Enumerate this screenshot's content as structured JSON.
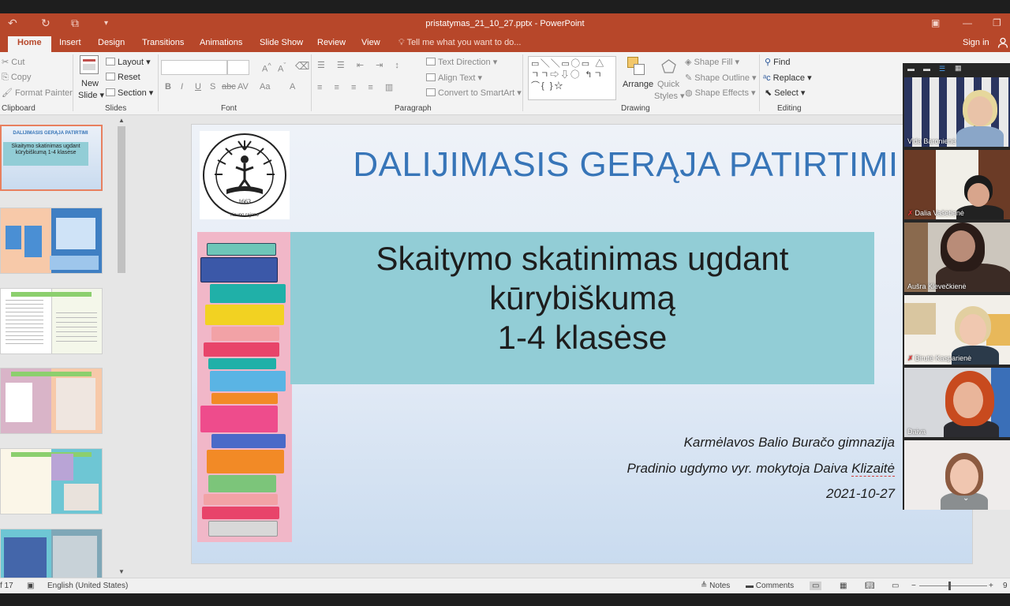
{
  "window": {
    "title": "pristatymas_21_10_27.pptx - PowerPoint",
    "sign_in": "Sign in"
  },
  "tabs": [
    "Home",
    "Insert",
    "Design",
    "Transitions",
    "Animations",
    "Slide Show",
    "Review",
    "View"
  ],
  "tell_me": "Tell me what you want to do...",
  "ribbon": {
    "clipboard": {
      "cut": "Cut",
      "copy": "Copy",
      "format_painter": "Format Painter",
      "group": "Clipboard"
    },
    "slides": {
      "new_slide": "New",
      "new_slide_2": "Slide",
      "layout": "Layout",
      "reset": "Reset",
      "section": "Section",
      "group": "Slides"
    },
    "font": {
      "group": "Font",
      "bold": "B",
      "italic": "I",
      "underline": "U",
      "strike": "S",
      "abc": "abc",
      "spacing": "AV",
      "case": "Aa",
      "color": "A"
    },
    "paragraph": {
      "text_direction": "Text Direction",
      "align_text": "Align Text",
      "convert_smartart": "Convert to SmartArt",
      "group": "Paragraph"
    },
    "drawing": {
      "arrange": "Arrange",
      "quick": "Quick",
      "styles": "Styles",
      "shape_fill": "Shape Fill",
      "shape_outline": "Shape Outline",
      "shape_effects": "Shape Effects",
      "group": "Drawing",
      "shapes": "▭╲╲▭◯▭ △ㄱㄱ⇨⇩◯ ↰ㄱ⌒{ }☆"
    },
    "editing": {
      "find": "Find",
      "replace": "Replace",
      "select": "Select",
      "group": "Editing"
    }
  },
  "slide": {
    "title": "DALIJIMASIS GERĄJA PATIRTIMI",
    "subtitle_lines": [
      "Skaitymo skatinimas ugdant",
      "kūrybiškumą",
      "1-4 klasėse"
    ],
    "logo_text": "Karmėlavos Balio Buračo gimnazija",
    "logo_year": "1663",
    "logo_bottom": "Kauno rajono",
    "author_school": "Karmėlavos Balio Buračo gimnazija",
    "author_role": "Pradinio ugdymo vyr. mokytoja Daiva ",
    "author_surname": "Klizaitė",
    "date": "2021-10-27"
  },
  "thumbnails": {
    "first_title": "DALIJIMASIS GERĄJA PATIRTIMI",
    "first_sub": "Skaitymo skatinimas ugdant kūrybiškumą 1-4 klasėse"
  },
  "participants": [
    {
      "name": "Vida Baronienė",
      "muted": false
    },
    {
      "name": "Dalia Vašėtienė",
      "muted": true
    },
    {
      "name": "Aušra Klevečkienė",
      "muted": false
    },
    {
      "name": "Birutė Kasparienė",
      "muted": true
    },
    {
      "name": "Daiva",
      "muted": false
    },
    {
      "name": "",
      "muted": false
    }
  ],
  "status": {
    "slide_of": "f 17",
    "language": "English (United States)",
    "notes": "Notes",
    "comments": "Comments",
    "zoom_label": "9"
  },
  "colors": {
    "accent": "#b7472a",
    "title_blue": "#3775b8",
    "teal": "#92cdd6",
    "book_pink": "#f1b7c8"
  }
}
